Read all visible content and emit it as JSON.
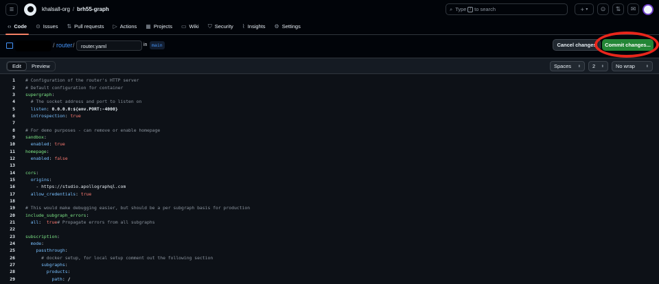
{
  "header": {
    "org": "khalsall-org",
    "repo": "brh55-graph",
    "search_placeholder": "to search",
    "search_prefix": "Type",
    "search_key": "/",
    "plus_label": "+",
    "plus_caret": "▾"
  },
  "tabs": [
    {
      "label": "Code",
      "icon": "‹›"
    },
    {
      "label": "Issues",
      "icon": "⊙"
    },
    {
      "label": "Pull requests",
      "icon": "⇅"
    },
    {
      "label": "Actions",
      "icon": "▷"
    },
    {
      "label": "Projects",
      "icon": "▦"
    },
    {
      "label": "Wiki",
      "icon": "▭"
    },
    {
      "label": "Security",
      "icon": "⛉"
    },
    {
      "label": "Insights",
      "icon": "⌇"
    },
    {
      "label": "Settings",
      "icon": "⚙"
    }
  ],
  "editbar": {
    "path_sep": "/",
    "folder": "router",
    "filename": "router.yaml",
    "in_label": "in",
    "branch": "main",
    "cancel_label": "Cancel changes",
    "commit_label": "Commit changes..."
  },
  "editor": {
    "edit_tab": "Edit",
    "preview_tab": "Preview",
    "indent_mode": "Spaces",
    "indent_size": "2",
    "wrap_mode": "No wrap"
  },
  "code_lines": [
    "# Configuration of the router's HTTP server",
    "# Default configuration for container",
    "supergraph:",
    "  # The socket address and port to listen on",
    "  listen: 0.0.0.0:${env.PORT:-4000}",
    "  introspection: true",
    "",
    "# For demo purposes - can remove or enable homepage",
    "sandbox:",
    "  enabled: true",
    "homepage:",
    "  enabled: false",
    "",
    "cors:",
    "  origins:",
    "    - https://studio.apollographql.com",
    "  allow_credentials: true",
    "",
    "# This would make debugging easier, but should be a per subgraph basis for production",
    "include_subgraph_errors:",
    "  all: true # Propagate errors from all subgraphs",
    "",
    "subscription:",
    "  mode:",
    "    passthrough:",
    "      # docker setup, for local setup comment out the following section",
    "      subgraphs:",
    "        products:",
    "          path: /"
  ]
}
